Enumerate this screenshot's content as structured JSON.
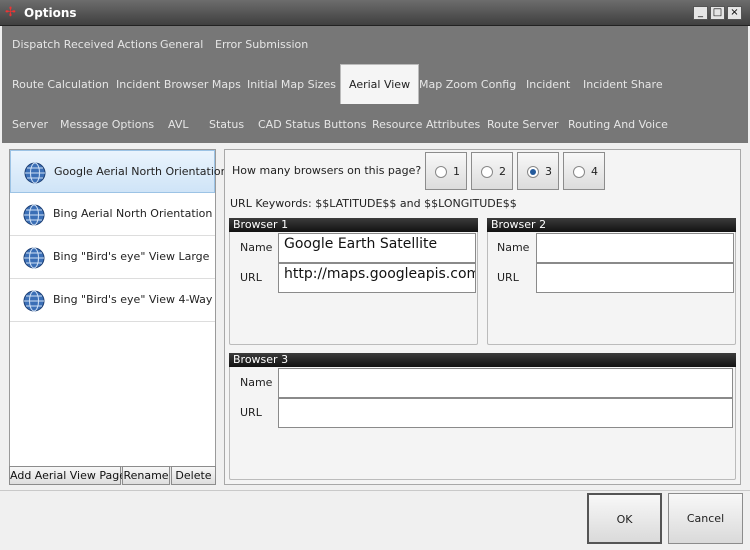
{
  "window": {
    "title": "Options",
    "minimize": "_",
    "maximize": "□",
    "close": "×"
  },
  "tabs": {
    "row1": [
      "Dispatch Received Actions",
      "General",
      "Error Submission"
    ],
    "row2": [
      "Route Calculation",
      "Incident Browser Maps",
      "Initial Map Sizes",
      "Aerial View",
      "Map Zoom Config",
      "Incident",
      "Incident Share"
    ],
    "row3": [
      "Server",
      "Message Options",
      "AVL",
      "Status",
      "CAD Status Buttons",
      "Resource Attributes",
      "Route Server",
      "Routing And Voice"
    ],
    "active": "Aerial View"
  },
  "pages": {
    "items": [
      "Google Aerial North Orientation",
      "Bing Aerial North Orientation",
      "Bing \"Bird's eye\" View Large",
      "Bing \"Bird's eye\" View 4-Way"
    ],
    "selected_index": 0,
    "add_label": "Add Aerial View Page",
    "rename_label": "Rename",
    "delete_label": "Delete"
  },
  "browsers": {
    "question": "How many browsers on this page?",
    "options": [
      "1",
      "2",
      "3",
      "4"
    ],
    "selected": "3",
    "keywords": "URL Keywords: $$LATITUDE$$ and $$LONGITUDE$$",
    "name_label": "Name",
    "url_label": "URL",
    "b1": {
      "title": "Browser 1",
      "name": "Google Earth Satellite",
      "url": "http://maps.googleapis.com"
    },
    "b2": {
      "title": "Browser 2",
      "name": "",
      "url": ""
    },
    "b3": {
      "title": "Browser 3",
      "name": "",
      "url": ""
    }
  },
  "dialog": {
    "ok_label": "OK",
    "cancel_label": "Cancel"
  },
  "colors": {
    "accent": "#235a9c",
    "tabbar": "#777777",
    "selected_item": "#cfe4f7"
  }
}
